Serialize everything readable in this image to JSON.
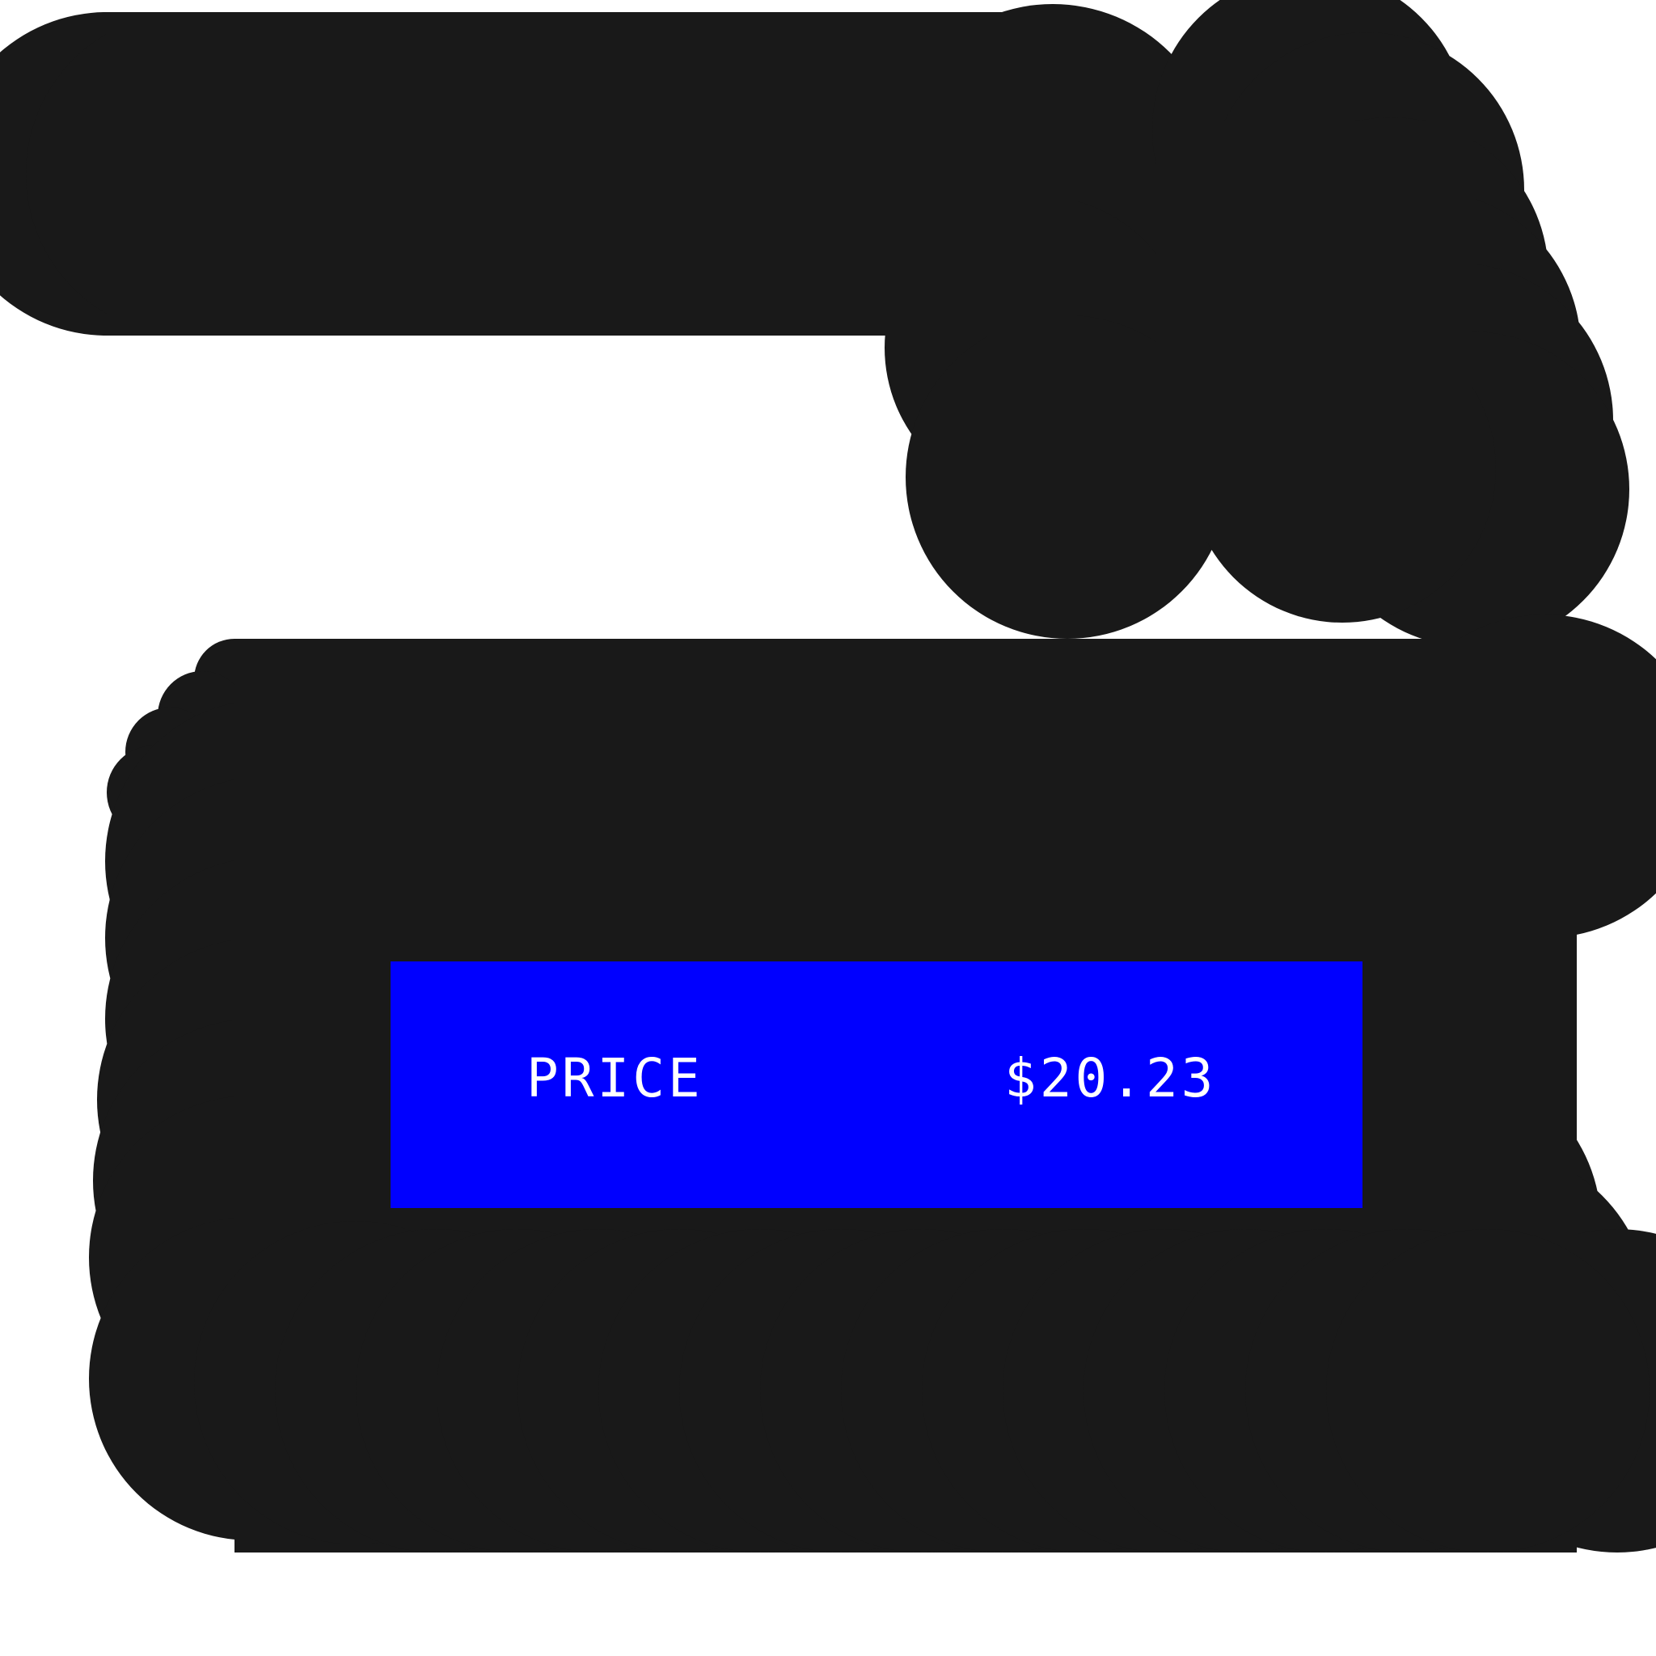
{
  "colors": {
    "background": "#ffffff",
    "scribble": "#191919",
    "panel": "#0000ff",
    "text": "#ffffff"
  },
  "price_panel": {
    "label": "PRICE",
    "value": "$20.23"
  }
}
